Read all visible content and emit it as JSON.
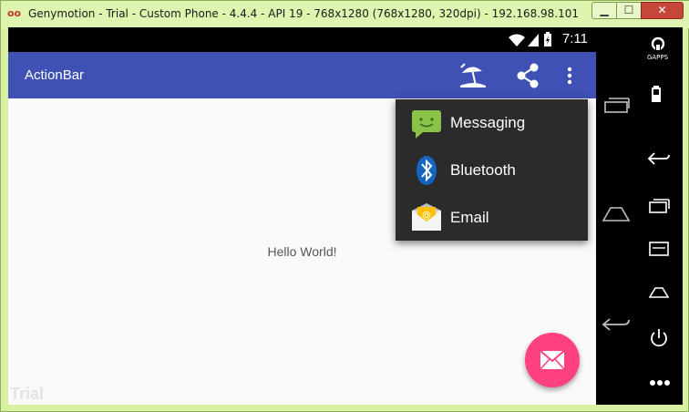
{
  "window": {
    "title": "Genymotion - Trial - Custom Phone - 4.4.4 - API 19 - 768x1280 (768x1280, 320dpi) - 192.168.98.101",
    "app_icon": "oo",
    "minimize_glyph": "▁",
    "maximize_glyph": "☐",
    "close_glyph": "✕"
  },
  "status_bar": {
    "time": "7:11",
    "icons": [
      "wifi-icon",
      "signal-icon",
      "battery-charging-icon"
    ]
  },
  "action_bar": {
    "title": "ActionBar",
    "color": "#3f51b5",
    "actions": [
      "beach-umbrella-icon",
      "share-icon",
      "overflow-menu-icon"
    ]
  },
  "popup_menu": {
    "items": [
      {
        "label": "Messaging",
        "icon": "messaging-icon"
      },
      {
        "label": "Bluetooth",
        "icon": "bluetooth-icon"
      },
      {
        "label": "Email",
        "icon": "email-icon"
      }
    ]
  },
  "content": {
    "hello_text": "Hello World!",
    "watermark": "Trial"
  },
  "fab": {
    "icon": "envelope-icon",
    "color": "#ff4081"
  },
  "side_nav": {
    "gapps_label": "GAPPS",
    "buttons": [
      "gapps-icon",
      "battery-icon",
      "back-icon",
      "recent-apps-icon",
      "menu-icon",
      "home-icon",
      "power-icon",
      "more-icon"
    ]
  }
}
